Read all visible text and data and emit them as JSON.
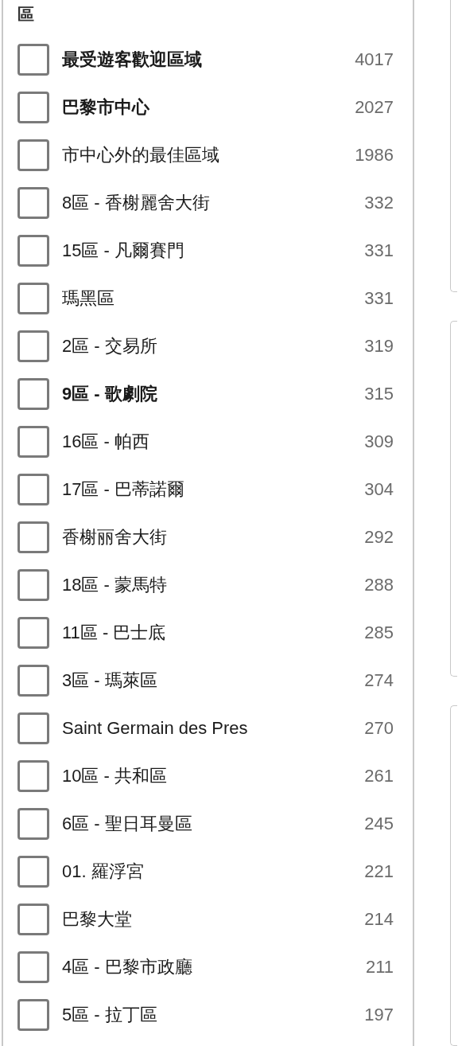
{
  "filter_panel": {
    "title": "區",
    "options": [
      {
        "label": "最受遊客歡迎區域",
        "count": "4017",
        "checked": false,
        "emphasized": true
      },
      {
        "label": "巴黎市中心",
        "count": "2027",
        "checked": false,
        "emphasized": true
      },
      {
        "label": "市中心外的最佳區域",
        "count": "1986",
        "checked": false,
        "emphasized": false
      },
      {
        "label": "8區 - 香榭麗舍大街",
        "count": "332",
        "checked": false,
        "emphasized": false
      },
      {
        "label": "15區 - 凡爾賽門",
        "count": "331",
        "checked": false,
        "emphasized": false
      },
      {
        "label": "瑪黑區",
        "count": "331",
        "checked": false,
        "emphasized": false
      },
      {
        "label": "2區 - 交易所",
        "count": "319",
        "checked": false,
        "emphasized": false
      },
      {
        "label": "9區 - 歌劇院",
        "count": "315",
        "checked": false,
        "emphasized": true
      },
      {
        "label": "16區 - 帕西",
        "count": "309",
        "checked": false,
        "emphasized": false
      },
      {
        "label": "17區 - 巴蒂諾爾",
        "count": "304",
        "checked": false,
        "emphasized": false
      },
      {
        "label": "香榭丽舍大街",
        "count": "292",
        "checked": false,
        "emphasized": false
      },
      {
        "label": "18區 - 蒙馬特",
        "count": "288",
        "checked": false,
        "emphasized": false
      },
      {
        "label": "11區 - 巴士底",
        "count": "285",
        "checked": false,
        "emphasized": false
      },
      {
        "label": "3區 - 瑪萊區",
        "count": "274",
        "checked": false,
        "emphasized": false
      },
      {
        "label": "Saint Germain des Pres",
        "count": "270",
        "checked": false,
        "emphasized": false
      },
      {
        "label": "10區 - 共和區",
        "count": "261",
        "checked": false,
        "emphasized": false
      },
      {
        "label": "6區 - 聖日耳曼區",
        "count": "245",
        "checked": false,
        "emphasized": false
      },
      {
        "label": "01. 羅浮宮",
        "count": "221",
        "checked": false,
        "emphasized": false
      },
      {
        "label": "巴黎大堂",
        "count": "214",
        "checked": false,
        "emphasized": false
      },
      {
        "label": "4區 - 巴黎市政廳",
        "count": "211",
        "checked": false,
        "emphasized": false
      },
      {
        "label": "5區 - 拉丁區",
        "count": "197",
        "checked": false,
        "emphasized": false
      }
    ]
  }
}
